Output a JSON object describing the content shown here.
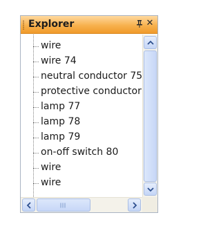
{
  "panel": {
    "title": "Explorer",
    "pin_glyph": "⊥",
    "close_glyph": "✕"
  },
  "tree": {
    "items": [
      {
        "label": "wire"
      },
      {
        "label": "wire 74"
      },
      {
        "label": "neutral conductor 75"
      },
      {
        "label": "protective conductor"
      },
      {
        "label": "lamp 77"
      },
      {
        "label": "lamp 78"
      },
      {
        "label": "lamp 79"
      },
      {
        "label": "on-off switch 80"
      },
      {
        "label": "wire"
      },
      {
        "label": "wire"
      }
    ]
  },
  "icons": {
    "grip": "grip-icon",
    "pin": "pin-icon",
    "close": "close-icon",
    "scroll_up": "arrow-up-icon",
    "scroll_down": "arrow-down-icon",
    "scroll_left": "arrow-left-icon",
    "scroll_right": "arrow-right-icon"
  },
  "colors": {
    "title_bar": "#f7b14e",
    "scroll_button": "#c4d5f6"
  }
}
